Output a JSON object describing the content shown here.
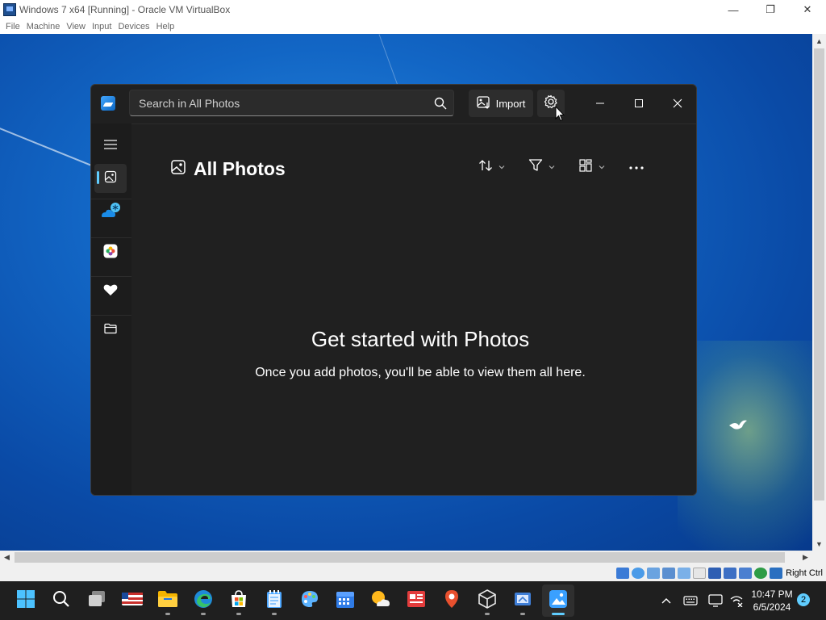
{
  "host": {
    "title": "Windows 7 x64 [Running] - Oracle VM VirtualBox",
    "window_controls": [
      "—",
      "❐",
      "✕"
    ],
    "menu": [
      "File",
      "Machine",
      "View",
      "Input",
      "Devices",
      "Help"
    ],
    "status_host_key": "Right Ctrl"
  },
  "photos": {
    "search_placeholder": "Search in All Photos",
    "import_label": "Import",
    "page_title": "All Photos",
    "empty_title": "Get started with Photos",
    "empty_subtitle": "Once you add photos, you'll be able to view them all here.",
    "nav": [
      "menu-icon",
      "all-photos-icon",
      "onedrive-icon",
      "icloud-photos-icon",
      "favorites-icon",
      "folders-icon"
    ],
    "accent": "#60cdff"
  },
  "taskbar": {
    "apps": [
      "start-icon",
      "search-icon",
      "task-view-icon",
      "msn-icon",
      "file-explorer-icon",
      "edge-icon",
      "store-icon",
      "notepad-icon",
      "paint-icon",
      "calendar-icon",
      "weather-icon",
      "news-icon",
      "maps-icon",
      "virtualbox-icon",
      "snipping-icon",
      "photos-icon"
    ],
    "time": "10:47 PM",
    "date": "6/5/2024",
    "notifications": "2"
  }
}
